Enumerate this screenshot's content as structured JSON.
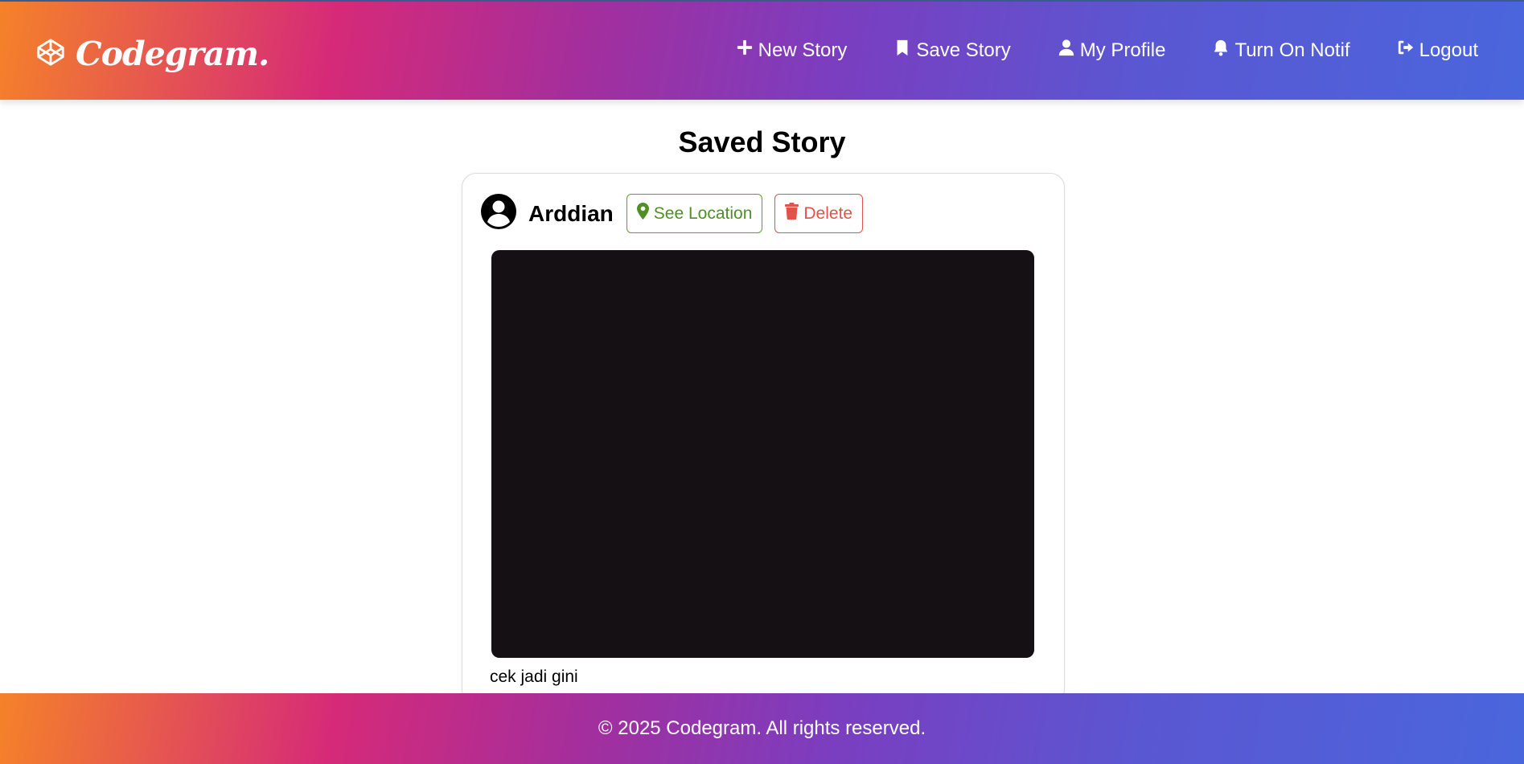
{
  "brand": {
    "name": "Codegram.",
    "icon": "codepen-cube-icon"
  },
  "nav": {
    "items": [
      {
        "label": "New Story",
        "icon": "plus-icon"
      },
      {
        "label": "Save Story",
        "icon": "bookmark-icon"
      },
      {
        "label": "My Profile",
        "icon": "user-icon"
      },
      {
        "label": "Turn On Notif",
        "icon": "bell-icon"
      },
      {
        "label": "Logout",
        "icon": "logout-icon"
      }
    ]
  },
  "main": {
    "title": "Saved Story",
    "stories": [
      {
        "author": "Arddian",
        "avatar_icon": "user-circle-icon",
        "location_button": "See Location",
        "delete_button": "Delete",
        "caption": "cek jadi gini"
      }
    ]
  },
  "footer": {
    "text": "© 2025 Codegram. All rights reserved."
  },
  "colors": {
    "gradient_start": "#f58229",
    "gradient_mid": "#d62a78",
    "gradient_end": "#4a66dc",
    "location_green": "#4f8f23",
    "delete_red": "#e0524a",
    "image_bg": "#141013"
  }
}
